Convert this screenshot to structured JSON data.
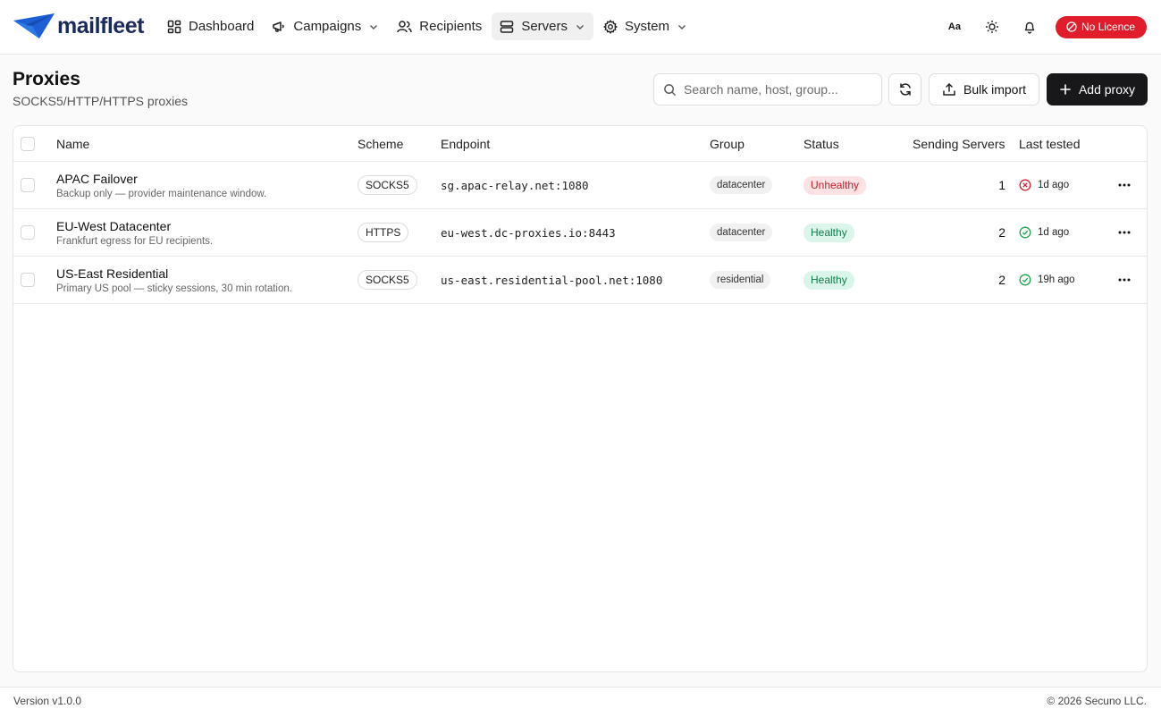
{
  "app": {
    "name": "mailfleet",
    "brand_color": "#1f5fd6",
    "icons": {
      "logo": "mailfleet-plane-icon",
      "dashboard": "dashboard-grid-icon",
      "campaigns": "megaphone-icon",
      "recipients": "users-icon",
      "servers": "server-icon",
      "system": "gear-icon",
      "font": "font-size-icon",
      "theme": "sun-icon",
      "notifications": "bell-icon"
    }
  },
  "nav": {
    "items": [
      {
        "label": "Dashboard"
      },
      {
        "label": "Campaigns"
      },
      {
        "label": "Recipients"
      },
      {
        "label": "Servers"
      },
      {
        "label": "System"
      }
    ],
    "font_toggle": "Aa",
    "licence": "No Licence",
    "licence_color": "#e11d2b"
  },
  "page": {
    "title": "Proxies",
    "subtitle": "SOCKS5/HTTP/HTTPS proxies"
  },
  "toolbar": {
    "search_placeholder": "Search name, host, group...",
    "bulk_import_label": "Bulk import",
    "add_proxy_label": "Add proxy"
  },
  "table": {
    "columns": [
      "Name",
      "Scheme",
      "Endpoint",
      "Group",
      "Status",
      "Sending Servers",
      "Last tested"
    ],
    "rows": [
      {
        "name": "APAC Failover",
        "description": "Backup only — provider maintenance window.",
        "scheme": "SOCKS5",
        "endpoint": "sg.apac-relay.net:1080",
        "group": "datacenter",
        "status": "Unhealthy",
        "sending_servers": "1",
        "last_tested": "1d ago"
      },
      {
        "name": "EU-West Datacenter",
        "description": "Frankfurt egress for EU recipients.",
        "scheme": "HTTPS",
        "endpoint": "eu-west.dc-proxies.io:8443",
        "group": "datacenter",
        "status": "Healthy",
        "sending_servers": "2",
        "last_tested": "1d ago"
      },
      {
        "name": "US-East Residential",
        "description": "Primary US pool — sticky sessions, 30 min rotation.",
        "scheme": "SOCKS5",
        "endpoint": "us-east.residential-pool.net:1080",
        "group": "residential",
        "status": "Healthy",
        "sending_servers": "2",
        "last_tested": "19h ago"
      }
    ]
  },
  "footer": {
    "version": "Version v1.0.0",
    "copyright": "© 2026 Secuno LLC."
  }
}
